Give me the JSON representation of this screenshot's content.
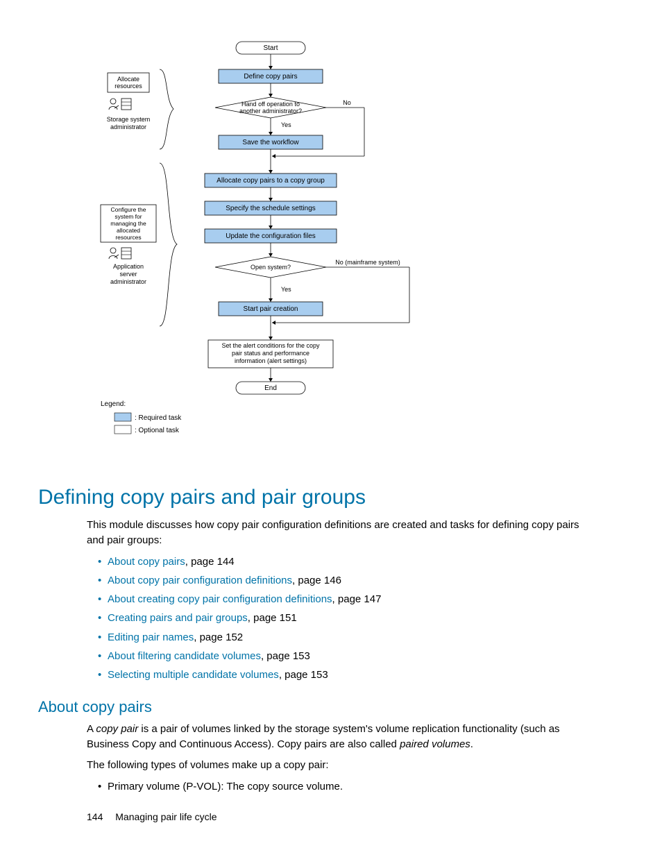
{
  "diagram": {
    "start": "Start",
    "define": "Define copy pairs",
    "handoff_l1": "Hand off operation to",
    "handoff_l2": "another administrator?",
    "handoff_no": "No",
    "handoff_yes": "Yes",
    "save": "Save the workflow",
    "allocate": "Allocate copy pairs to a copy group",
    "schedule": "Specify the schedule settings",
    "update": "Update the configuration files",
    "open_q": "Open system?",
    "open_no": "No (mainframe system)",
    "open_yes": "Yes",
    "startpair": "Start pair creation",
    "alert_l1": "Set the alert conditions for the copy",
    "alert_l2": "pair status and performance",
    "alert_l3": "information (alert settings)",
    "end": "End",
    "role1_l1": "Allocate",
    "role1_l2": "resources",
    "role1_caption_l1": "Storage system",
    "role1_caption_l2": "administrator",
    "role2_l1": "Configure the",
    "role2_l2": "system for",
    "role2_l3": "managing the",
    "role2_l4": "allocated",
    "role2_l5": "resources",
    "role2_caption_l1": "Application",
    "role2_caption_l2": "server",
    "role2_caption_l3": "administrator",
    "legend_title": "Legend:",
    "legend_required": ": Required task",
    "legend_optional": ": Optional task"
  },
  "heading": "Defining copy pairs and pair groups",
  "intro": "This module discusses how copy pair configuration definitions are created and tasks for defining copy pairs and pair groups:",
  "links": [
    {
      "text": "About copy pairs",
      "suffix": ", page 144"
    },
    {
      "text": "About copy pair configuration definitions",
      "suffix": ", page 146"
    },
    {
      "text": "About creating copy pair configuration definitions",
      "suffix": ", page 147"
    },
    {
      "text": "Creating pairs and pair groups",
      "suffix": ", page 151"
    },
    {
      "text": "Editing pair names",
      "suffix": ", page 152"
    },
    {
      "text": "About filtering candidate volumes",
      "suffix": ", page 153"
    },
    {
      "text": "Selecting multiple candidate volumes",
      "suffix": ", page 153"
    }
  ],
  "sub_heading": "About copy pairs",
  "para1_a": "A ",
  "para1_em": "copy pair",
  "para1_b": " is a pair of volumes linked by the storage system's volume replication functionality (such as Business Copy and Continuous Access). Copy pairs are also called ",
  "para1_em2": "paired volumes",
  "para1_c": ".",
  "para2": "The following types of volumes make up a copy pair:",
  "bullet1": "Primary volume (P-VOL): The copy source volume.",
  "footer_page": "144",
  "footer_title": "Managing pair life cycle"
}
